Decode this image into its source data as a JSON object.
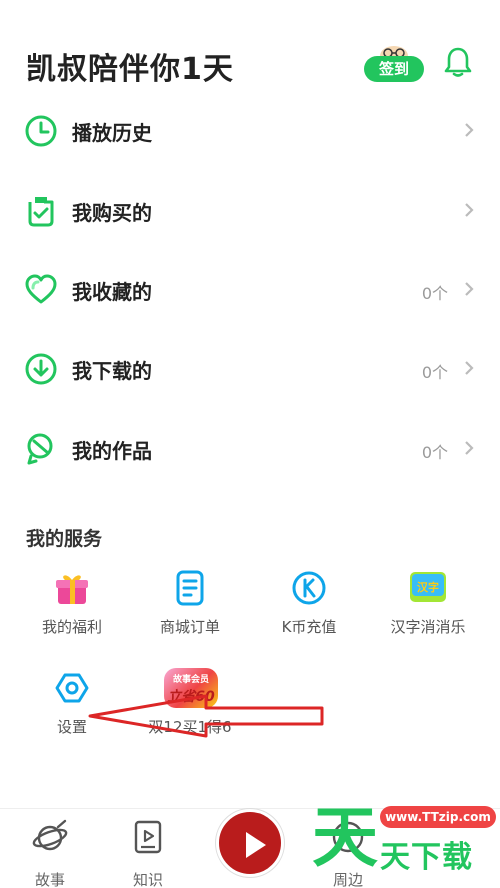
{
  "header": {
    "title": "凯叔陪伴你1天",
    "checkin_label": "签到"
  },
  "menu": [
    {
      "label": "播放历史",
      "count": ""
    },
    {
      "label": "我购买的",
      "count": ""
    },
    {
      "label": "我收藏的",
      "count": "0个"
    },
    {
      "label": "我下载的",
      "count": "0个"
    },
    {
      "label": "我的作品",
      "count": "0个"
    }
  ],
  "services": {
    "title": "我的服务",
    "items": [
      {
        "label": "我的福利",
        "icon": "gift-icon"
      },
      {
        "label": "商城订单",
        "icon": "order-doc-icon"
      },
      {
        "label": "K币充值",
        "icon": "k-coin-icon"
      },
      {
        "label": "汉字消消乐",
        "icon": "hanzi-game-icon",
        "icon_text": "汉字"
      },
      {
        "label": "设置",
        "icon": "settings-hexagon-icon"
      },
      {
        "label": "双12买1得6",
        "icon": "promo-badge",
        "badge_line1": "故事会员",
        "badge_line2": "立省60"
      }
    ]
  },
  "tabbar": {
    "tabs": [
      {
        "label": "故事",
        "icon": "planet-icon"
      },
      {
        "label": "知识",
        "icon": "video-book-icon"
      },
      {
        "label": "",
        "icon": "play-center-icon"
      },
      {
        "label": "周边",
        "icon": "shop-icon"
      }
    ]
  },
  "watermark": {
    "big_char": "天",
    "url": "www.TTzip.com",
    "text": "天下载"
  },
  "colors": {
    "accent": "#22c55e",
    "annotation": "#dc2626"
  }
}
